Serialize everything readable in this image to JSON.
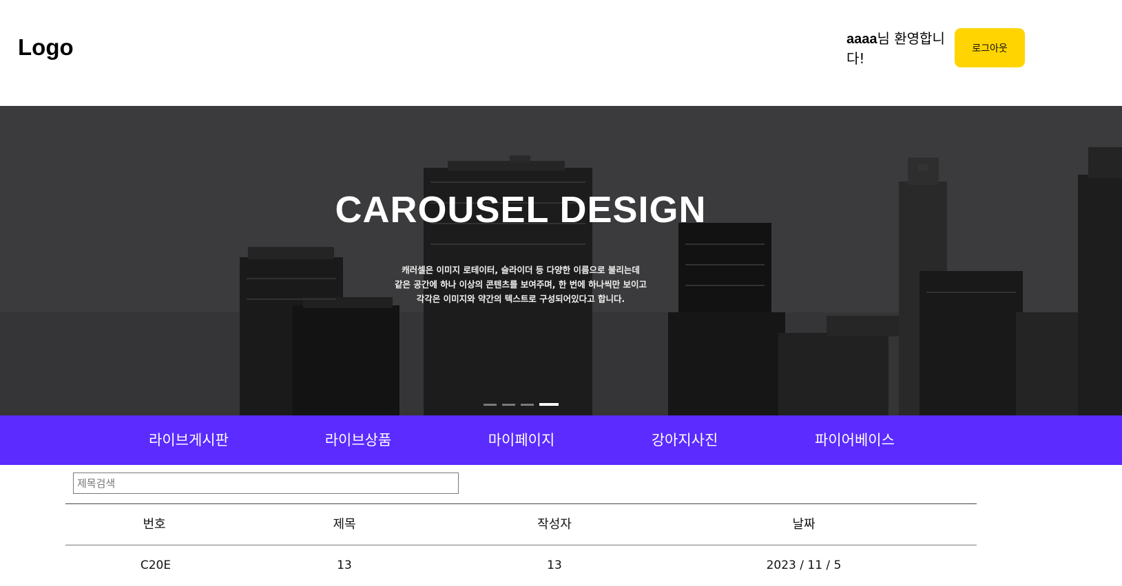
{
  "header": {
    "logo": "Logo",
    "welcome_user": "aaaa",
    "welcome_suffix": "님 환영합니다!",
    "logout_label": "로그아웃"
  },
  "carousel": {
    "title": "CAROUSEL DESIGN",
    "description": [
      "캐러셀은 이미지 로테이터, 슬라이더 등 다양한 이름으로 불리는데",
      "같은 공간에 하나 이상의 콘텐츠를 보여주며, 한 번에 하나씩만 보이고",
      "각각은 이미지와 약간의 텍스트로 구성되어있다고 합니다."
    ],
    "slide_count": 4,
    "active_slide": 4
  },
  "nav": {
    "items": [
      "라이브게시판",
      "라이브상품",
      "마이페이지",
      "강아지사진",
      "파이어베이스"
    ]
  },
  "search": {
    "placeholder": "제목검색",
    "value": ""
  },
  "table": {
    "columns": [
      "번호",
      "제목",
      "작성자",
      "날짜"
    ],
    "rows": [
      [
        "C20E",
        "13",
        "13",
        "2023 / 11 / 5"
      ]
    ]
  },
  "colors": {
    "logout_button": "#ffd400",
    "nav_background": "#5b2bff",
    "carousel_background": "#3c3c3e"
  }
}
